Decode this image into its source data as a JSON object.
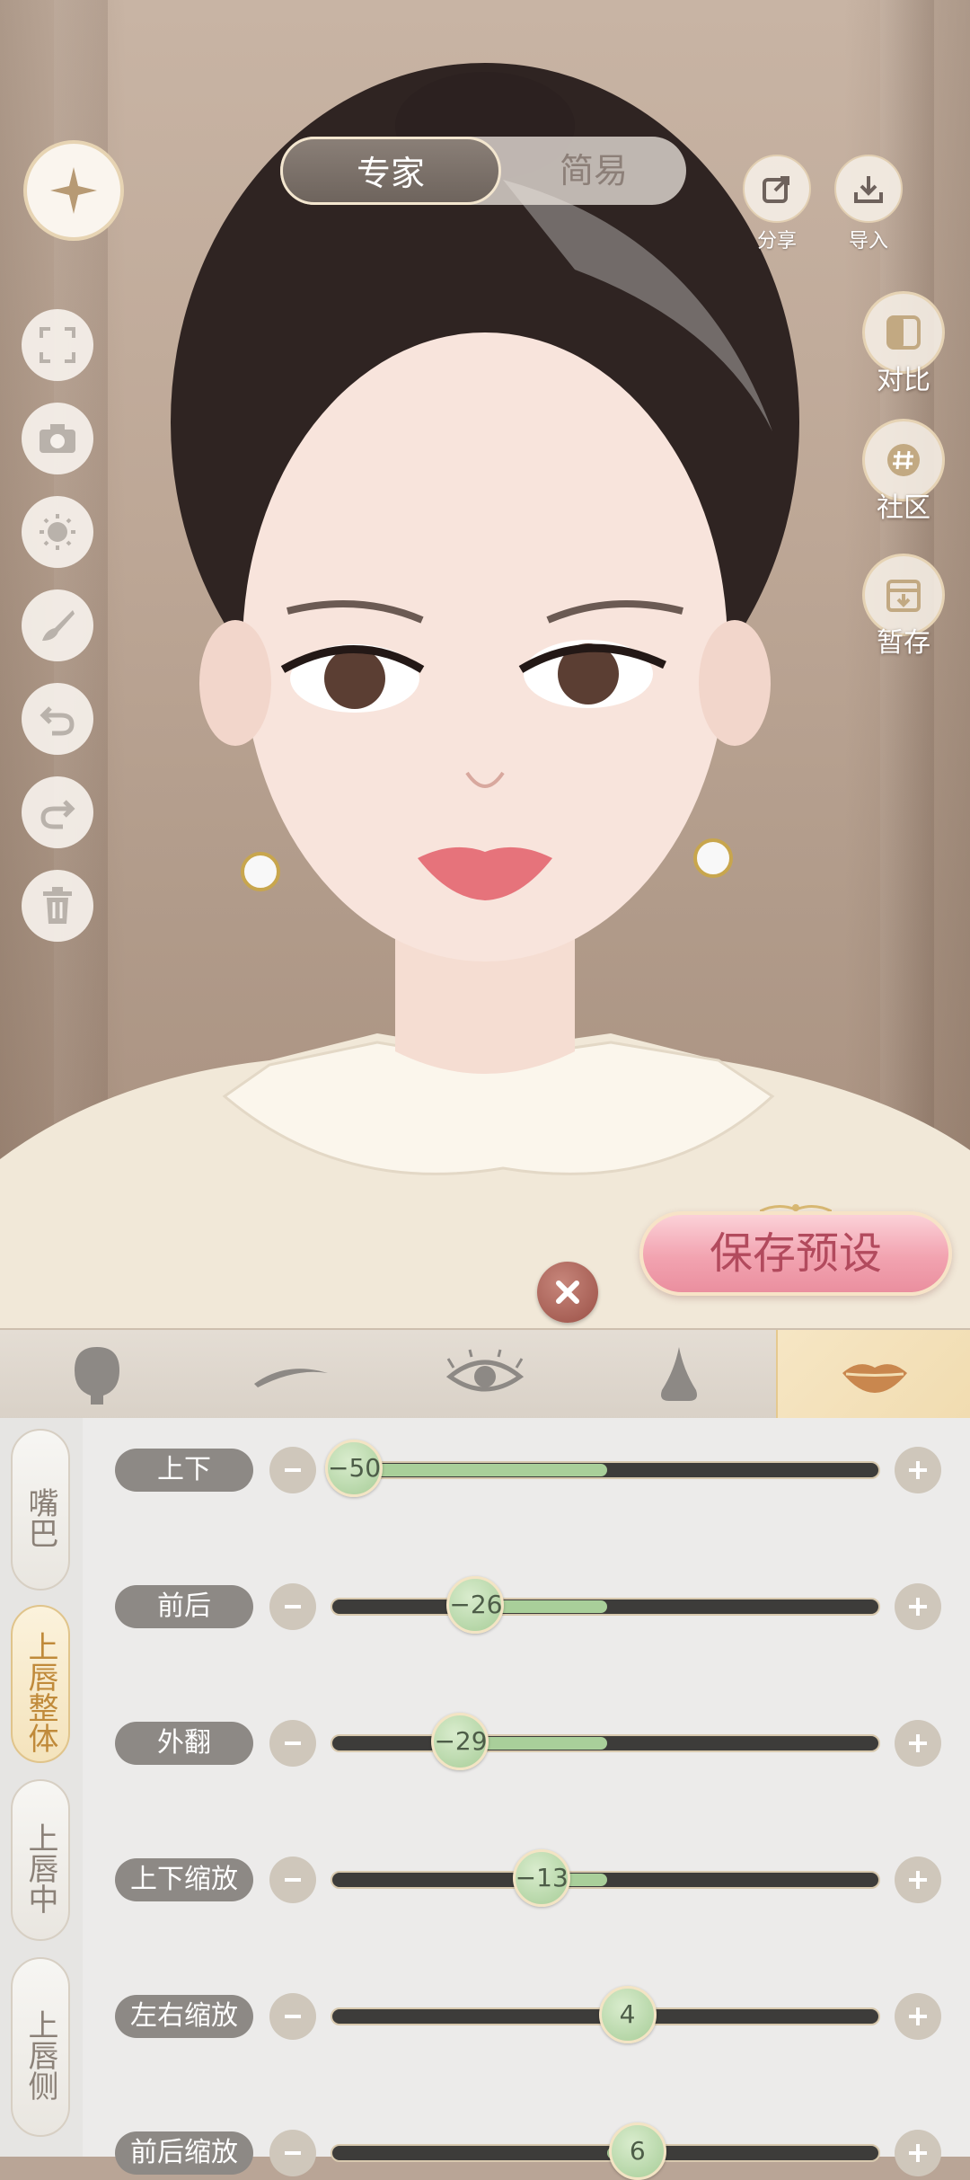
{
  "mode_toggle": {
    "expert_label": "专家",
    "simple_label": "简易",
    "selected": "专家"
  },
  "top_actions": {
    "share_label": "分享",
    "import_label": "导入"
  },
  "left_tools": [
    "fullscreen-icon",
    "camera-icon",
    "lighting-icon",
    "brush-icon",
    "undo-icon",
    "redo-icon",
    "trash-icon"
  ],
  "right_actions": {
    "compare_label": "对比",
    "community_label": "社区",
    "temp_save_label": "暂存"
  },
  "save_preset_label": "保存预设",
  "category_tabs": [
    "face-shape-icon",
    "eyebrow-icon",
    "eye-icon",
    "nose-icon",
    "lips-icon"
  ],
  "active_category": "lips-icon",
  "sub_nav": [
    {
      "label": "嘴巴",
      "active": false
    },
    {
      "label": "上唇整体",
      "active": true
    },
    {
      "label": "上唇中",
      "active": false
    },
    {
      "label": "上唇侧",
      "active": false
    }
  ],
  "sliders": [
    {
      "label": "上下",
      "value": -50,
      "value_text": "−50"
    },
    {
      "label": "前后",
      "value": -26,
      "value_text": "−26"
    },
    {
      "label": "外翻",
      "value": -29,
      "value_text": "−29"
    },
    {
      "label": "上下缩放",
      "value": -13,
      "value_text": "−13"
    },
    {
      "label": "左右缩放",
      "value": 4,
      "value_text": "4"
    },
    {
      "label": "前后缩放",
      "value": 6,
      "value_text": "6"
    }
  ],
  "slider_range": [
    -50,
    50
  ],
  "colors": {
    "accent_gold": "#e0c48b",
    "slider_fill": "#a9cf9a",
    "save_button_pink": "#f2a3b0"
  }
}
